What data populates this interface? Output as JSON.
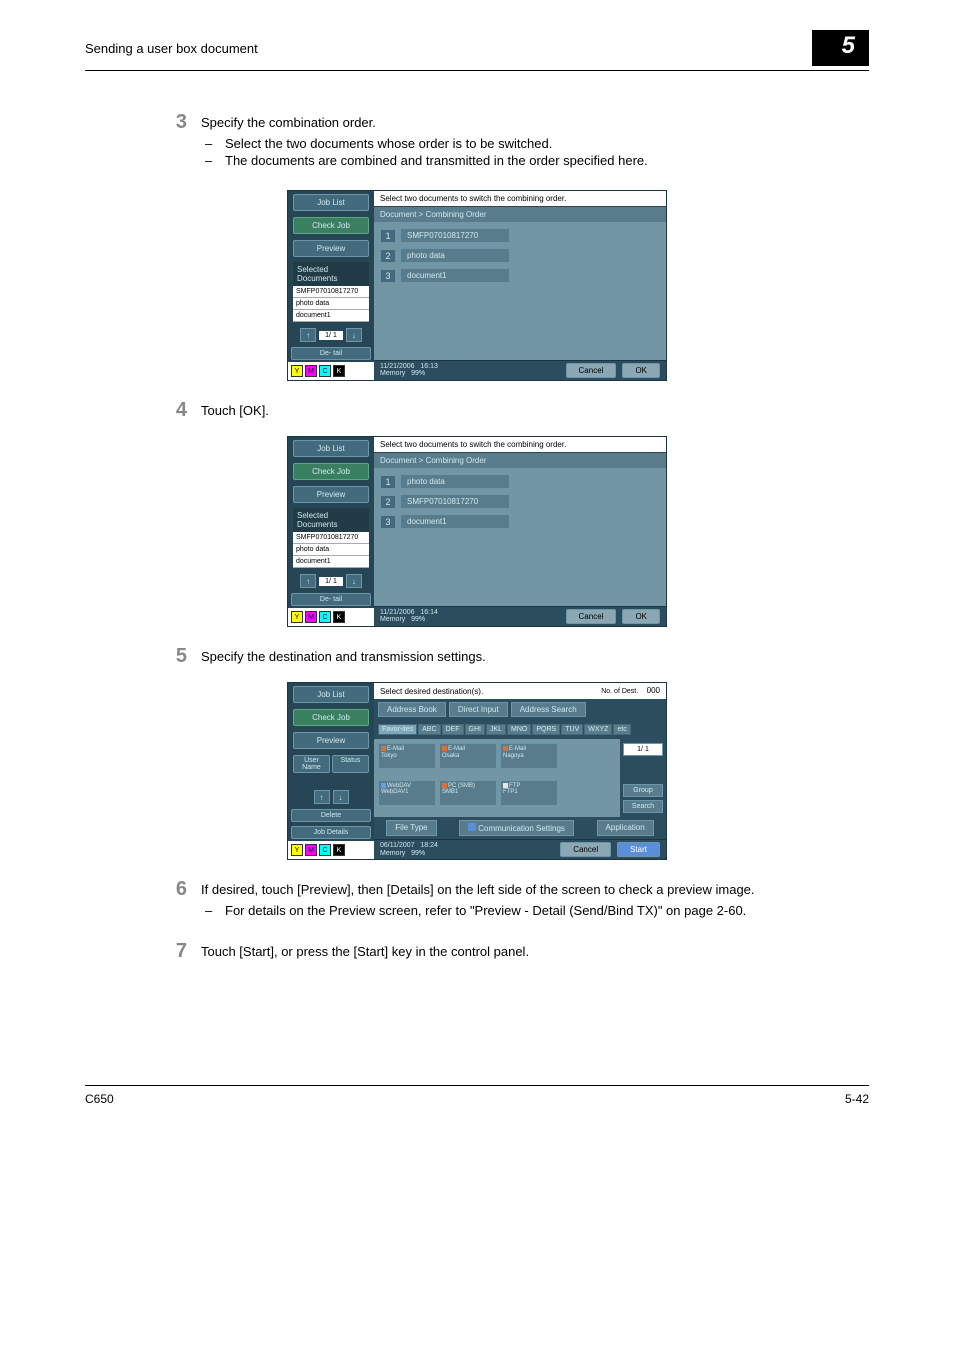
{
  "header": {
    "title": "Sending a user box document",
    "chapter": "5"
  },
  "steps": {
    "s3": {
      "num": "3",
      "text": "Specify the combination order.",
      "bullets": [
        "Select the two documents whose order is to be switched.",
        "The documents are combined and transmitted in the order specified here."
      ]
    },
    "s4": {
      "num": "4",
      "text": "Touch [OK]."
    },
    "s5": {
      "num": "5",
      "text": "Specify the destination and transmission settings."
    },
    "s6": {
      "num": "6",
      "text": "If desired, touch [Preview], then [Details] on the left side of the screen to check a preview image.",
      "bullets": [
        "For details on the Preview screen, refer to \"Preview - Detail (Send/Bind TX)\" on page 2-60."
      ]
    },
    "s7": {
      "num": "7",
      "text": "Touch [Start], or press the [Start] key in the control panel."
    }
  },
  "common": {
    "job_list": "Job List",
    "check_job": "Check Job",
    "preview": "Preview",
    "selected_docs": "Selected Documents",
    "detail": "De-\ntail",
    "cancel": "Cancel",
    "ok": "OK",
    "memory": "Memory",
    "mem_pct": "99%"
  },
  "screen3": {
    "msg": "Select two documents to switch the combining order.",
    "breadcrumb": "Document > Combining Order",
    "docs": [
      "SMFP07010817270",
      "photo data",
      "document1"
    ],
    "order": [
      "SMFP07010817270",
      "photo data",
      "document1"
    ],
    "page": "1/  1",
    "date": "11/21/2006",
    "time": "16:13"
  },
  "screen4": {
    "msg": "Select two documents to switch the combining order.",
    "breadcrumb": "Document > Combining Order",
    "docs": [
      "SMFP07010817270",
      "photo data",
      "document1"
    ],
    "order": [
      "photo data",
      "SMFP07010817270",
      "document1"
    ],
    "page": "1/  1",
    "date": "11/21/2006",
    "time": "16:14"
  },
  "screen5": {
    "msg": "Select desired destination(s).",
    "no_of_dest": "No. of Dest.",
    "no_of_dest_val": "000",
    "tabs": {
      "addr": "Address Book",
      "direct": "Direct Input",
      "search": "Address Search"
    },
    "user_name": "User Name",
    "status": "Status",
    "delete": "Delete",
    "job_details": "Job Details",
    "letters": [
      "Favor-ites",
      "ABC",
      "DEF",
      "GHI",
      "JKL",
      "MNO",
      "PQRS",
      "TUV",
      "WXYZ",
      "etc"
    ],
    "dests": [
      {
        "type": "E-Mail",
        "name": "Tokyo",
        "color": "#e07030"
      },
      {
        "type": "E-Mail",
        "name": "Osaka",
        "color": "#e07030"
      },
      {
        "type": "E-Mail",
        "name": "Nagoya",
        "color": "#e07030"
      },
      {
        "type": "WebDAV",
        "name": "WebDAV1",
        "color": "#6aa0e0"
      },
      {
        "type": "PC (SMB)",
        "name": "SMB1",
        "color": "#e07030"
      },
      {
        "type": "FTP",
        "name": "FTP1",
        "color": "#e8e8e8"
      }
    ],
    "page": "1/  1",
    "group": "Group",
    "search_btn": "Search",
    "app_tabs": {
      "file": "File Type",
      "comm": "Communication Settings",
      "app": "Application"
    },
    "start": "Start",
    "date": "06/11/2007",
    "time": "18:24"
  },
  "footer": {
    "left": "C650",
    "right": "5-42"
  }
}
